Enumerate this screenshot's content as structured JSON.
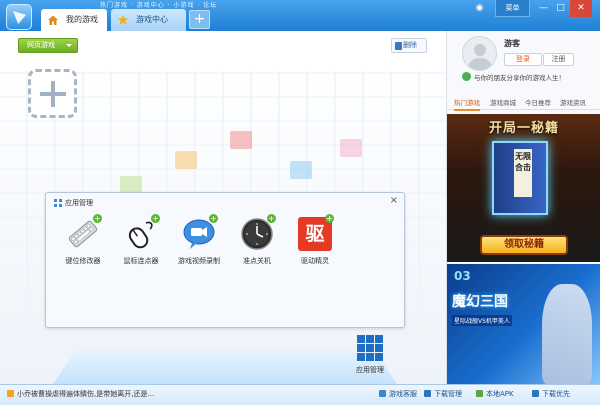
{
  "titlebar": {
    "strip_text": "热门游戏 · 游戏中心 · 小游戏 · 论坛",
    "tabs": [
      {
        "label": "我的游戏",
        "active": true
      },
      {
        "label": "游戏中心",
        "active": false
      }
    ],
    "add_tab": "+",
    "menu_label": "菜单",
    "controls": {
      "wechat": "◉",
      "minimize": "—",
      "maximize": "□",
      "close": "✕"
    }
  },
  "toolbar": {
    "webgame_label": "网页游戏",
    "delete_label": "删除"
  },
  "add_game": {
    "symbol": "+"
  },
  "app_panel": {
    "title": "应用管理",
    "close": "×",
    "apps": [
      {
        "label": "键位修改器",
        "icon": "keyboard-icon"
      },
      {
        "label": "鼠标连点器",
        "icon": "mouse-icon"
      },
      {
        "label": "游戏视频录制",
        "icon": "video-record-icon"
      },
      {
        "label": "准点关机",
        "icon": "clock-icon"
      },
      {
        "label": "驱动精灵",
        "icon": "driver-genius-icon",
        "glyph": "驱"
      }
    ]
  },
  "app_manager": {
    "label": "应用管理"
  },
  "user": {
    "name": "游客",
    "login_label": "登录",
    "register_label": "注册",
    "share_text": "与你的朋友分享你的游戏人生！"
  },
  "side_tabs": [
    {
      "label": "热门游戏",
      "active": true
    },
    {
      "label": "游戏商城",
      "active": false
    },
    {
      "label": "今日推荐",
      "active": false
    },
    {
      "label": "游戏资讯",
      "active": false
    }
  ],
  "banners": [
    {
      "title": "开局一秘籍",
      "book_text": "无限合击",
      "cta": "领取秘籍"
    },
    {
      "number": "03",
      "title": "魔幻三国",
      "subtitle": "星际战舰VS机甲美人"
    }
  ],
  "status": {
    "news": "小乔被曹操虐得遍体鳞伤,是带她离开,还是...",
    "buttons": [
      {
        "label": "游戏客服",
        "color": "#3a86d0"
      },
      {
        "label": "下载管理",
        "color": "#2c73c0"
      },
      {
        "label": "本地APK",
        "color": "#5ba542"
      },
      {
        "label": "下载优先",
        "color": "#2c73c0"
      }
    ]
  },
  "colors": {
    "titlebar": "#2f8fe0",
    "accent_green": "#6cae21",
    "accent_orange": "#f08a2c",
    "close_red": "#d8473a"
  }
}
